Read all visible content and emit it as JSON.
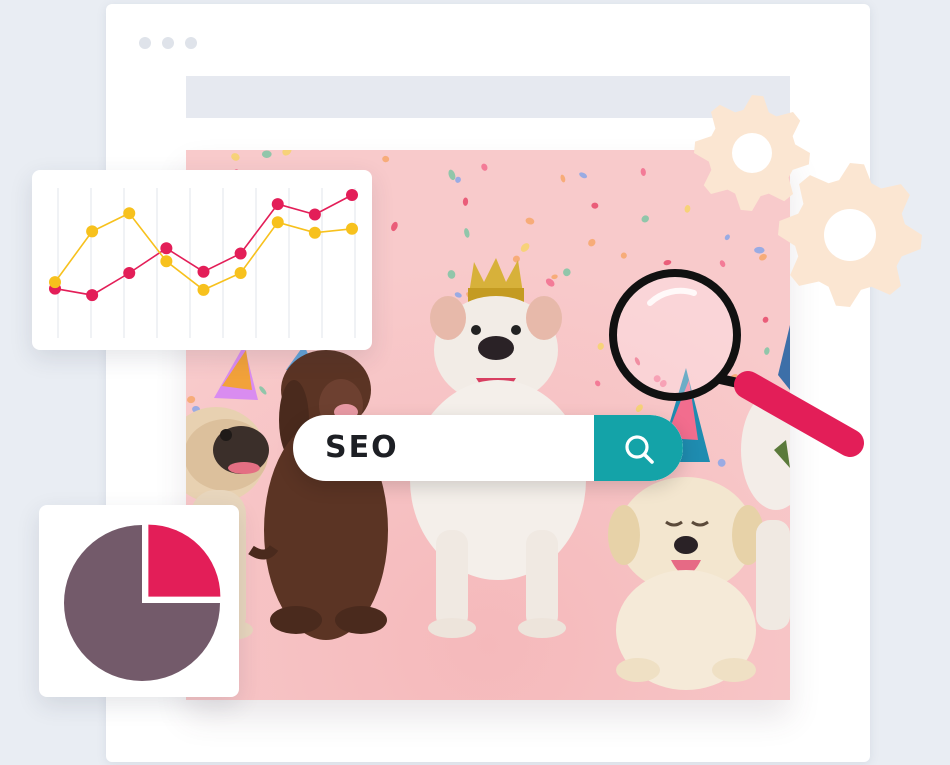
{
  "search": {
    "query": "SEO",
    "button_icon": "search-icon"
  },
  "colors": {
    "accent_red": "#e31e58",
    "accent_yellow": "#f7c11d",
    "teal": "#14a3a8",
    "pie_purple": "#735a6a",
    "gear_peach": "#fbe6d2",
    "hero_pink": "#f7c7c8"
  },
  "line_chart": {
    "series": [
      {
        "color": "#e31e58",
        "values": [
          0.28,
          0.23,
          0.4,
          0.59,
          0.41,
          0.55,
          0.93,
          0.85,
          1.0
        ]
      },
      {
        "color": "#f7c11d",
        "values": [
          0.33,
          0.72,
          0.86,
          0.49,
          0.27,
          0.4,
          0.79,
          0.71,
          0.74
        ]
      }
    ]
  },
  "pie_chart": {
    "slices": [
      {
        "fraction": 0.25,
        "color": "#e31e58"
      },
      {
        "fraction": 0.75,
        "color": "#735a6a"
      }
    ]
  },
  "decor": {
    "gears": [
      "gear-icon",
      "gear-icon"
    ],
    "magnifier": "magnifier-icon"
  }
}
